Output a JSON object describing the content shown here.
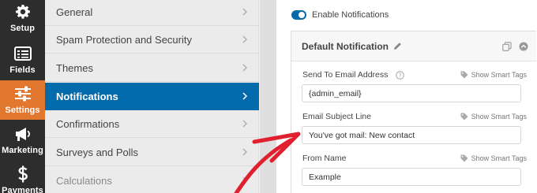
{
  "toolbar": {
    "items": [
      {
        "label": "Setup",
        "icon": "gear-icon"
      },
      {
        "label": "Fields",
        "icon": "list-icon"
      },
      {
        "label": "Settings",
        "icon": "sliders-icon"
      },
      {
        "label": "Marketing",
        "icon": "megaphone-icon"
      },
      {
        "label": "Payments",
        "icon": "dollar-icon"
      }
    ],
    "active_color": "#e27730",
    "bg_color": "#2d2d2d"
  },
  "settings_menu": {
    "items": [
      {
        "label": "General"
      },
      {
        "label": "Spam Protection and Security"
      },
      {
        "label": "Themes"
      },
      {
        "label": "Notifications"
      },
      {
        "label": "Confirmations"
      },
      {
        "label": "Surveys and Polls"
      },
      {
        "label": "Calculations"
      }
    ],
    "active": "Notifications",
    "active_color": "#036aab"
  },
  "notifications": {
    "enable_label": "Enable Notifications",
    "enabled": true,
    "card_title": "Default Notification",
    "smart_tags_label": "Show Smart Tags",
    "fields": [
      {
        "label": "Send To Email Address",
        "value": "{admin_email}"
      },
      {
        "label": "Email Subject Line",
        "value": "You've got mail: New contact"
      },
      {
        "label": "From Name",
        "value": "Example"
      }
    ]
  },
  "annotation": {
    "color": "#e0202e"
  }
}
